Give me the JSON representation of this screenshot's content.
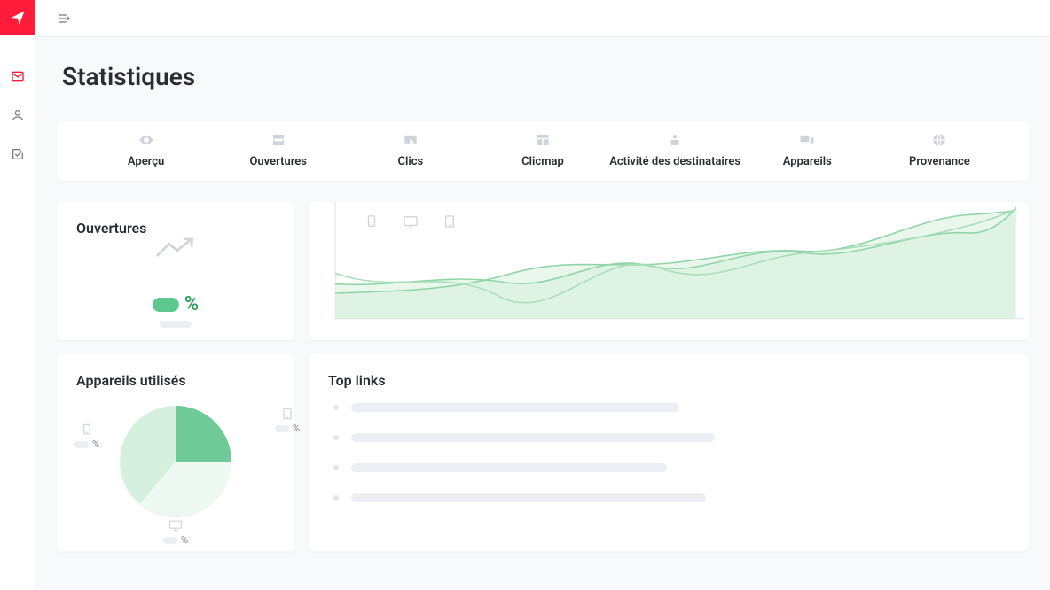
{
  "page": {
    "title": "Statistiques"
  },
  "tabs": [
    {
      "label": "Aperçu",
      "icon": "eye"
    },
    {
      "label": "Ouvertures",
      "icon": "inbox"
    },
    {
      "label": "Clics",
      "icon": "pointer"
    },
    {
      "label": "Clicmap",
      "icon": "layout"
    },
    {
      "label": "Activité des destinataires",
      "icon": "person"
    },
    {
      "label": "Appareils",
      "icon": "devices"
    },
    {
      "label": "Provenance",
      "icon": "globe"
    }
  ],
  "cards": {
    "ouvertures": {
      "title": "Ouvertures",
      "percent_symbol": "%"
    },
    "devices": {
      "title": "Appareils utilisés",
      "items": [
        {
          "type": "mobile",
          "percent_symbol": "%"
        },
        {
          "type": "tablet",
          "percent_symbol": "%"
        },
        {
          "type": "desktop",
          "percent_symbol": "%"
        }
      ]
    },
    "toplinks": {
      "title": "Top links"
    }
  },
  "chart_data": {
    "type": "area",
    "title": "",
    "xlabel": "",
    "ylabel": "",
    "ylim": [
      0,
      100
    ],
    "series": [
      {
        "name": "mobile",
        "values": [
          22,
          24,
          26,
          40,
          34,
          46,
          48,
          62,
          58,
          90,
          94
        ]
      },
      {
        "name": "tablet",
        "values": [
          30,
          26,
          38,
          30,
          56,
          44,
          64,
          56,
          78,
          74,
          98
        ]
      },
      {
        "name": "desktop",
        "values": [
          40,
          20,
          44,
          16,
          60,
          42,
          50,
          56,
          68,
          80,
          96
        ]
      }
    ],
    "legend_icons": [
      "mobile",
      "tablet",
      "desktop"
    ]
  },
  "colors": {
    "accent": "#ff1b3a",
    "chart_area": "#d7f0df",
    "chart_line": "#a8ddb9",
    "pie_slice1": "#6ecb97",
    "pie_slice2": "#d6f0df",
    "pie_slice3": "#edf9f1"
  }
}
